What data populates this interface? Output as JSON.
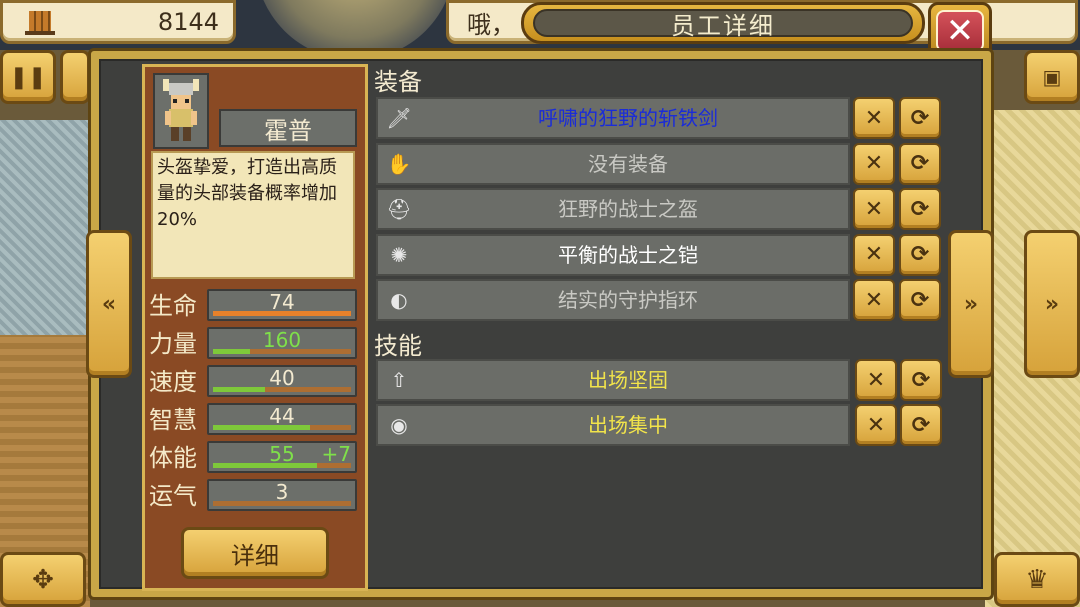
{
  "topbar": {
    "money": "8144",
    "message": "哦，",
    "title": "员工详细",
    "close_label": "✕"
  },
  "character": {
    "name": "霍普",
    "description": "头盔挚爱，打造出高质量的头部装备概率增加20%",
    "stats": [
      {
        "label": "生命",
        "value": "74",
        "bonus": "",
        "fill": 1.0,
        "value_color": "#f3ead0"
      },
      {
        "label": "力量",
        "value": "160",
        "bonus": "",
        "fill": 0.27,
        "value_color": "#7fe04a"
      },
      {
        "label": "速度",
        "value": "40",
        "bonus": "",
        "fill": 0.38,
        "value_color": "#f3ead0"
      },
      {
        "label": "智慧",
        "value": "44",
        "bonus": "",
        "fill": 0.7,
        "value_color": "#f3ead0"
      },
      {
        "label": "体能",
        "value": "55",
        "bonus": "+7",
        "fill": 0.75,
        "value_color": "#7fe04a"
      },
      {
        "label": "运气",
        "value": "3",
        "bonus": "",
        "fill": 0.0,
        "value_color": "#f3ead0"
      }
    ],
    "detail_button": "详细"
  },
  "equipment": {
    "title": "装备",
    "items": [
      {
        "icon": "sword-icon",
        "glyph": "🗡",
        "name": "呼啸的狂野的斩铁剑",
        "color": "#1a2cd8"
      },
      {
        "icon": "glove-icon",
        "glyph": "✋",
        "name": "没有装备",
        "color": "#c9c9c4"
      },
      {
        "icon": "helmet-icon",
        "glyph": "⛑",
        "name": "狂野的战士之盔",
        "color": "#c9c9c4"
      },
      {
        "icon": "armor-icon",
        "glyph": "✺",
        "name": "平衡的战士之铠",
        "color": "#ffffff"
      },
      {
        "icon": "ring-icon",
        "glyph": "◐",
        "name": "结实的守护指环",
        "color": "#c9c9c4"
      }
    ]
  },
  "skills": {
    "title": "技能",
    "items": [
      {
        "icon": "defense-up-icon",
        "glyph": "⇧",
        "name": "出场坚固",
        "color": "#f2e44a"
      },
      {
        "icon": "focus-eye-icon",
        "glyph": "◉",
        "name": "出场集中",
        "color": "#f2e44a"
      }
    ]
  },
  "buttons": {
    "remove_glyph": "✕",
    "swap_glyph": "⟳",
    "pause_glyph": "❚❚",
    "prev_glyph": "«",
    "next_glyph": "»",
    "camera_glyph": "▣",
    "move_glyph": "✥",
    "crown_glyph": "♛"
  }
}
